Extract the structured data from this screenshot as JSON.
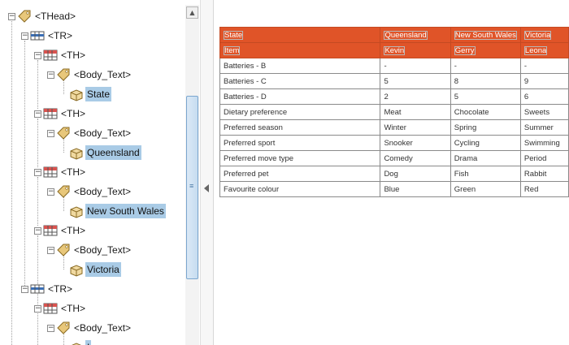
{
  "tag_tree": {
    "nodes": [
      {
        "label": "<THead>",
        "icon": "tag-icon"
      },
      {
        "label": "<TR>",
        "icon": "table-row-icon"
      },
      {
        "label": "<TH>",
        "icon": "table-header-cell-icon"
      },
      {
        "label": "<Body_Text>",
        "icon": "tag-icon"
      },
      {
        "label": "State",
        "icon": "content-container-icon"
      },
      {
        "label": "<TH>",
        "icon": "table-header-cell-icon"
      },
      {
        "label": "<Body_Text>",
        "icon": "tag-icon"
      },
      {
        "label": "Queensland",
        "icon": "content-container-icon"
      },
      {
        "label": "<TH>",
        "icon": "table-header-cell-icon"
      },
      {
        "label": "<Body_Text>",
        "icon": "tag-icon"
      },
      {
        "label": "New South Wales",
        "icon": "content-container-icon"
      },
      {
        "label": "<TH>",
        "icon": "table-header-cell-icon"
      },
      {
        "label": "<Body_Text>",
        "icon": "tag-icon"
      },
      {
        "label": "Victoria",
        "icon": "content-container-icon"
      },
      {
        "label": "<TR>",
        "icon": "table-row-icon"
      },
      {
        "label": "<TH>",
        "icon": "table-header-cell-icon"
      },
      {
        "label": "<Body_Text>",
        "icon": "tag-icon"
      },
      {
        "label": "I",
        "icon": "content-container-icon"
      }
    ]
  },
  "colors": {
    "header_orange": "#e05428",
    "selection_blue": "#a9cbe6"
  },
  "document_table": {
    "header_rows": [
      [
        "State",
        "Queensland",
        "New South Wales",
        "Victoria"
      ],
      [
        "Item",
        "Kevin",
        "Gerry",
        "Leona"
      ]
    ],
    "body_rows": [
      [
        "Batteries - B",
        "-",
        "-",
        "-"
      ],
      [
        "Batteries - C",
        "5",
        "8",
        "9"
      ],
      [
        "Batteries - D",
        "2",
        "5",
        "6"
      ],
      [
        "Dietary preference",
        "Meat",
        "Chocolate",
        "Sweets"
      ],
      [
        "Preferred season",
        "Winter",
        "Spring",
        "Summer"
      ],
      [
        "Preferred sport",
        "Snooker",
        "Cycling",
        "Swimming"
      ],
      [
        "Preferred move type",
        "Comedy",
        "Drama",
        "Period"
      ],
      [
        "Preferred pet",
        "Dog",
        "Fish",
        "Rabbit"
      ],
      [
        "Favourite colour",
        "Blue",
        "Green",
        "Red"
      ]
    ]
  }
}
